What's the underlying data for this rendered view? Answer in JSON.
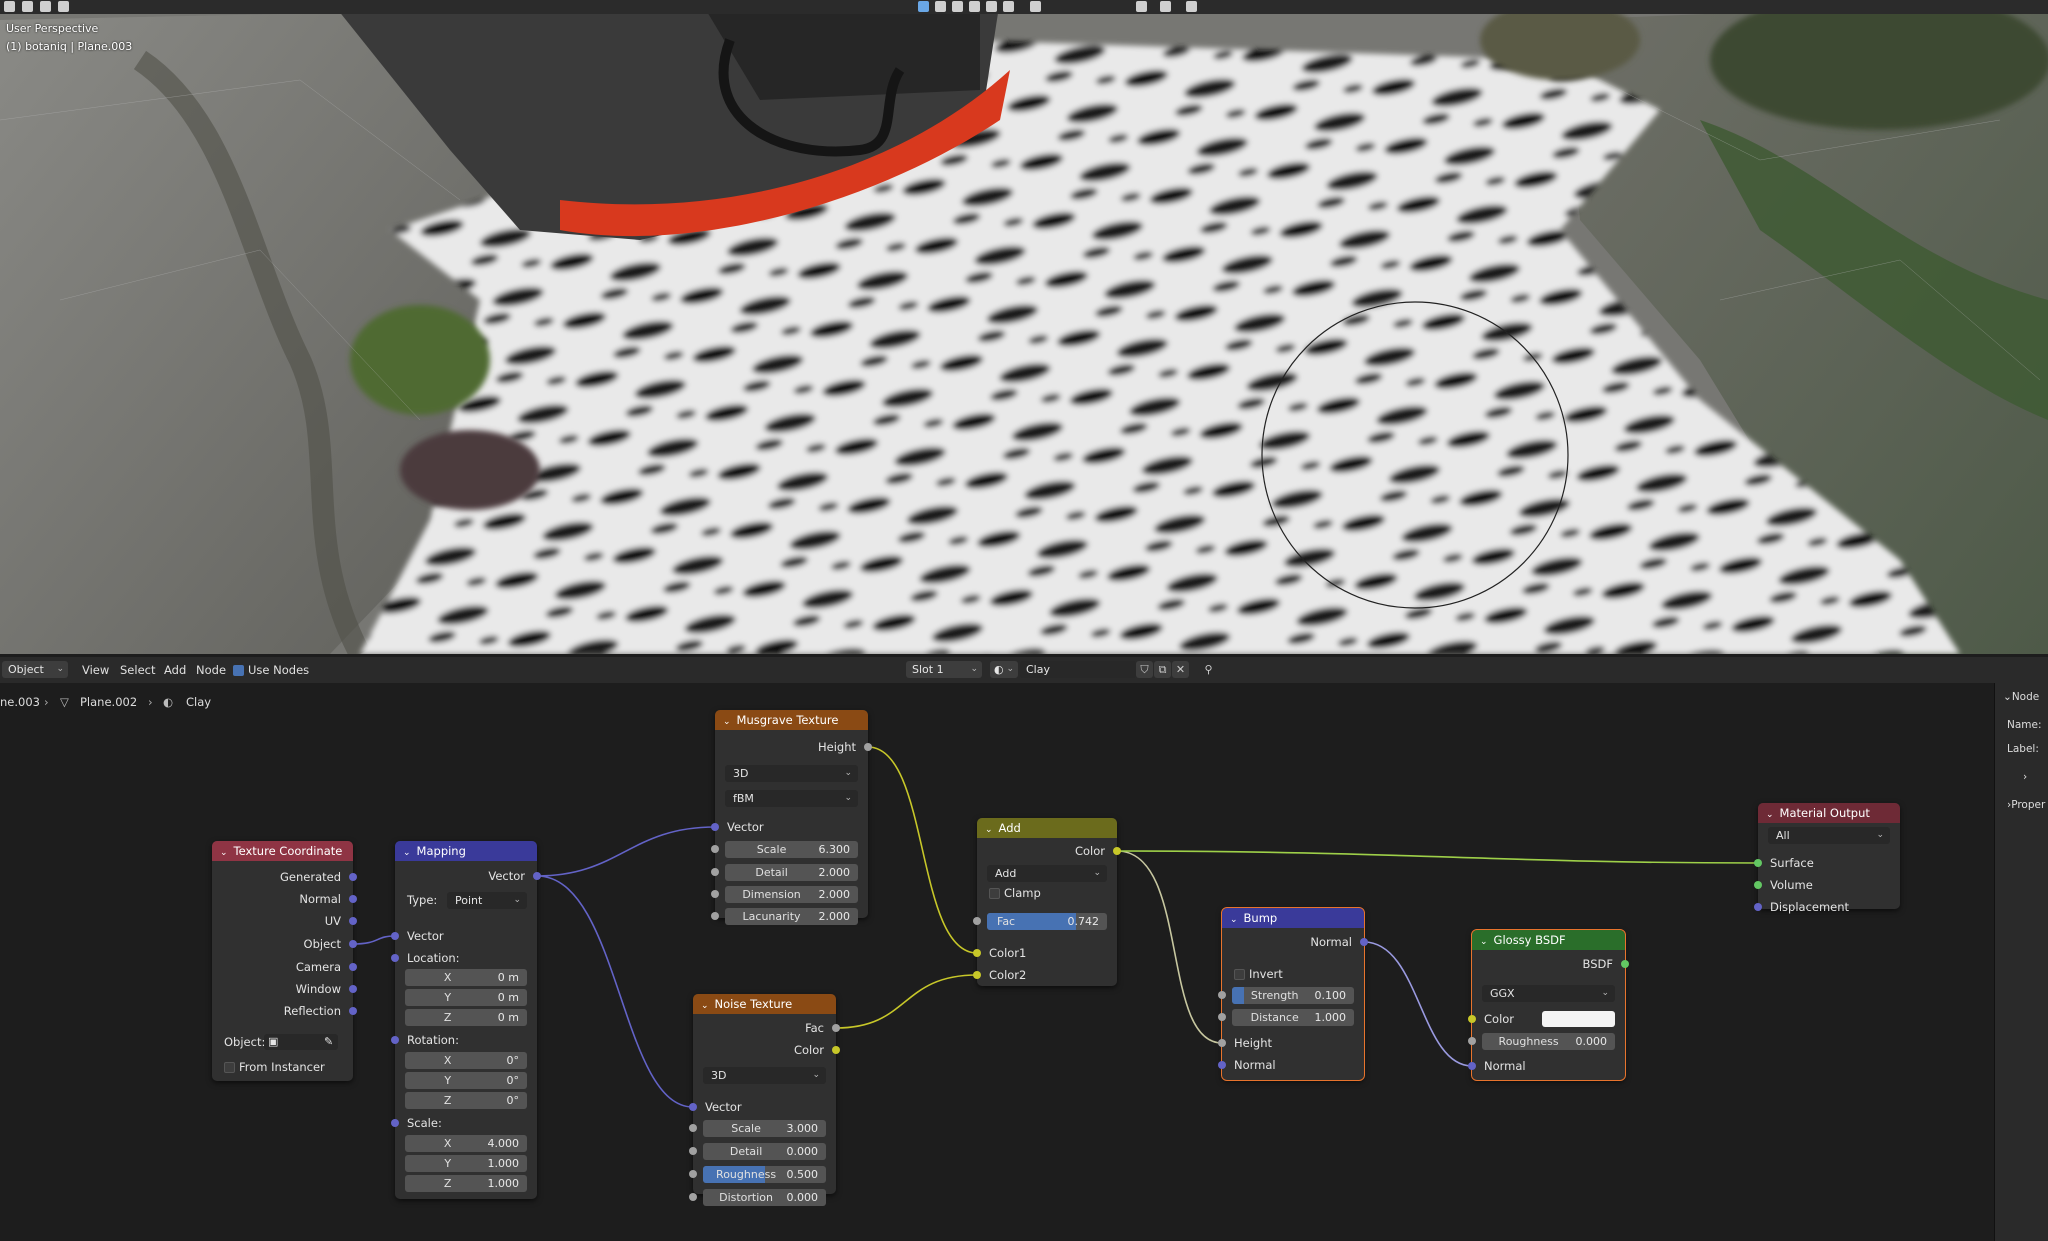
{
  "viewport": {
    "mode_label": "User Perspective",
    "object_label": "(1) botaniq | Plane.003"
  },
  "node_header": {
    "mode": "Object",
    "menu_view": "View",
    "menu_select": "Select",
    "menu_add": "Add",
    "menu_node": "Node",
    "use_nodes_label": "Use Nodes",
    "use_nodes_checked": true,
    "slot": "Slot 1",
    "material": "Clay"
  },
  "breadcrumb": {
    "object": "ne.003",
    "mesh": "Plane.002",
    "material": "Clay"
  },
  "nodes": {
    "texture_coordinate": {
      "title": "Texture Coordinate",
      "outputs": [
        "Generated",
        "Normal",
        "UV",
        "Object",
        "Camera",
        "Window",
        "Reflection"
      ],
      "object_label": "Object:",
      "from_instancer": "From Instancer"
    },
    "mapping": {
      "title": "Mapping",
      "output": "Vector",
      "type_label": "Type:",
      "type_value": "Point",
      "vector_label": "Vector",
      "location_label": "Location:",
      "location": [
        {
          "axis": "X",
          "value": "0 m"
        },
        {
          "axis": "Y",
          "value": "0 m"
        },
        {
          "axis": "Z",
          "value": "0 m"
        }
      ],
      "rotation_label": "Rotation:",
      "rotation": [
        {
          "axis": "X",
          "value": "0°"
        },
        {
          "axis": "Y",
          "value": "0°"
        },
        {
          "axis": "Z",
          "value": "0°"
        }
      ],
      "scale_label": "Scale:",
      "scale": [
        {
          "axis": "X",
          "value": "4.000"
        },
        {
          "axis": "Y",
          "value": "1.000"
        },
        {
          "axis": "Z",
          "value": "1.000"
        }
      ]
    },
    "musgrave": {
      "title": "Musgrave Texture",
      "output": "Height",
      "dimensions": "3D",
      "type": "fBM",
      "vector_label": "Vector",
      "fields": [
        {
          "label": "Scale",
          "value": "6.300"
        },
        {
          "label": "Detail",
          "value": "2.000"
        },
        {
          "label": "Dimension",
          "value": "2.000"
        },
        {
          "label": "Lacunarity",
          "value": "2.000"
        }
      ]
    },
    "noise": {
      "title": "Noise Texture",
      "outputs": [
        "Fac",
        "Color"
      ],
      "dimensions": "3D",
      "vector_label": "Vector",
      "fields": [
        {
          "label": "Scale",
          "value": "3.000"
        },
        {
          "label": "Detail",
          "value": "0.000"
        },
        {
          "label": "Roughness",
          "value": "0.500",
          "fill": 0.5
        },
        {
          "label": "Distortion",
          "value": "0.000"
        }
      ]
    },
    "add": {
      "title": "Add",
      "output": "Color",
      "blend": "Add",
      "clamp_label": "Clamp",
      "fac_label": "Fac",
      "fac_value": "0.742",
      "fac_fraction": 0.742,
      "inputs": [
        "Color1",
        "Color2"
      ]
    },
    "bump": {
      "title": "Bump",
      "output": "Normal",
      "invert_label": "Invert",
      "strength_label": "Strength",
      "strength_value": "0.100",
      "strength_fraction": 0.1,
      "distance_label": "Distance",
      "distance_value": "1.000",
      "inputs": [
        "Height",
        "Normal"
      ]
    },
    "glossy": {
      "title": "Glossy BSDF",
      "output": "BSDF",
      "distribution": "GGX",
      "color_label": "Color",
      "color_value": "#f4f4f4",
      "roughness_label": "Roughness",
      "roughness_value": "0.000",
      "normal_label": "Normal"
    },
    "output": {
      "title": "Material Output",
      "target": "All",
      "inputs": [
        "Surface",
        "Volume",
        "Displacement"
      ]
    }
  },
  "sidebar": {
    "node_tab": "Node",
    "name_label": "Name:",
    "label_label": "Label:",
    "properties_label": "Proper"
  },
  "colors": {
    "header_input": "#8f3444",
    "header_vector": "#3a3a9a",
    "header_texture": "#8a4a14",
    "header_color": "#6b6b1c",
    "header_shader": "#2a6e2a",
    "header_output": "#6e2a36",
    "accent_blue": "#4772b3",
    "selection_orange": "#e8742d"
  }
}
